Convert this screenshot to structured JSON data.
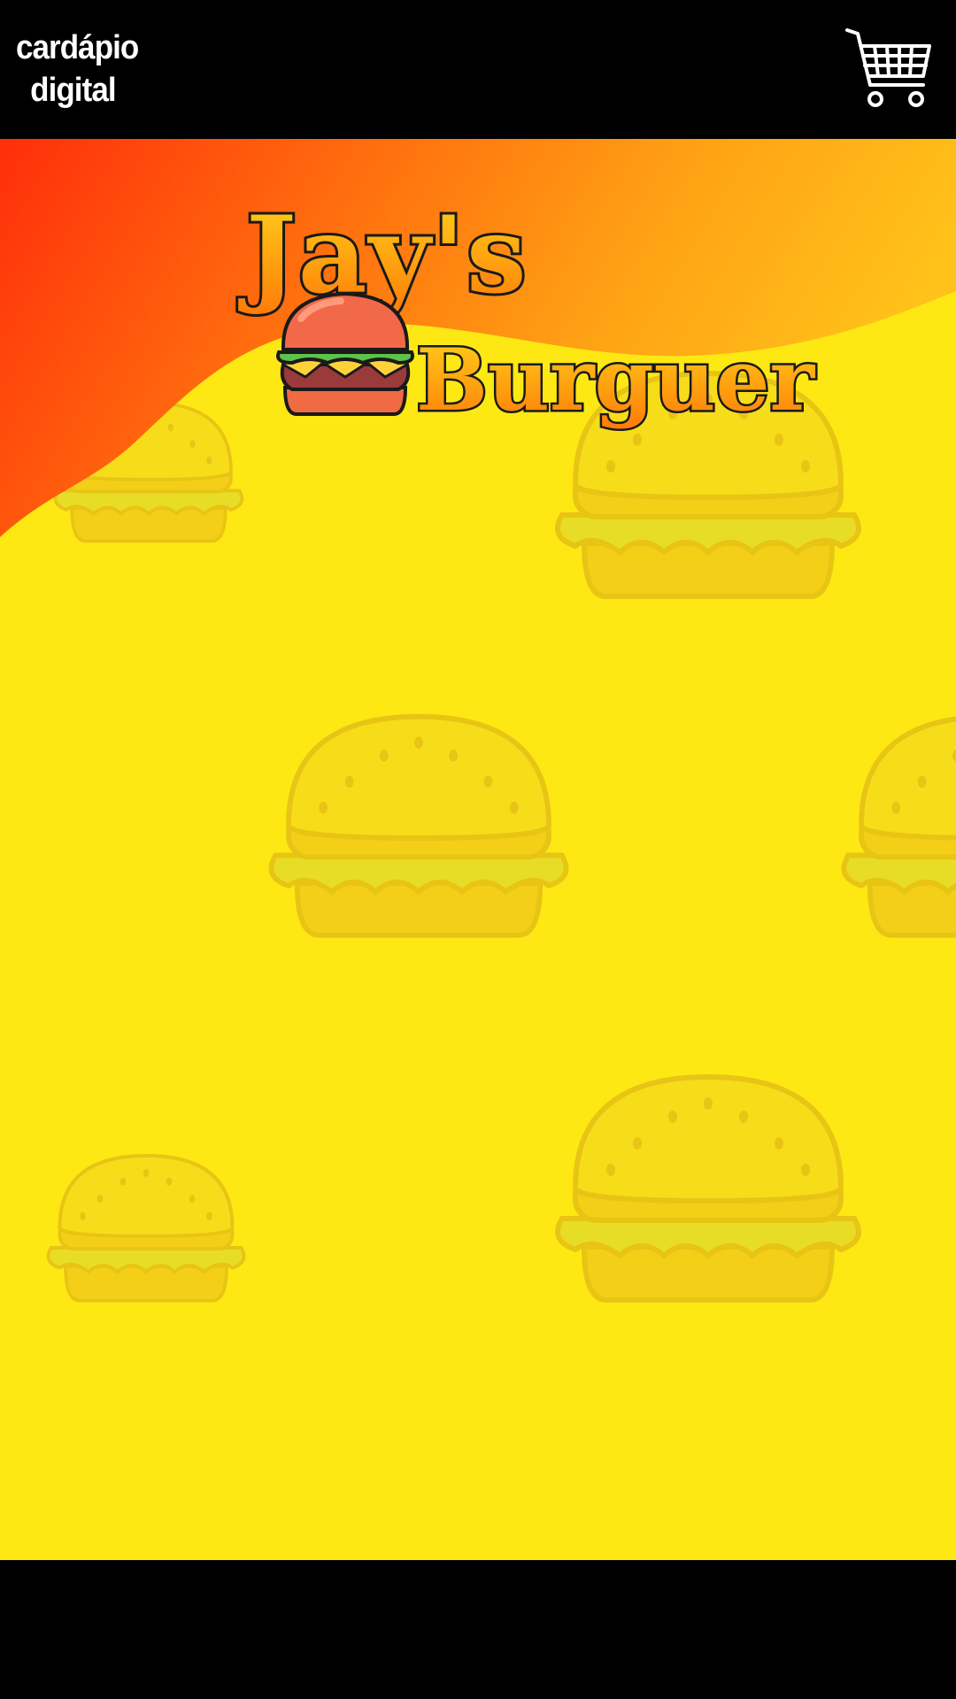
{
  "header": {
    "brand_line1": "cardápio",
    "brand_line2": "digital",
    "cart_icon": "shopping-cart-icon"
  },
  "logo": {
    "line1": "Jay's",
    "line2": "Burguer",
    "icon": "burger-icon"
  },
  "colors": {
    "header_bg": "#000000",
    "page_bg": "#fde814",
    "gradient_start": "#ff2e0a",
    "gradient_end": "#ffc21a",
    "logo_text_start": "#ffd21a",
    "logo_text_end": "#ff7a08"
  },
  "background": {
    "pattern_icon": "burger-icon"
  }
}
